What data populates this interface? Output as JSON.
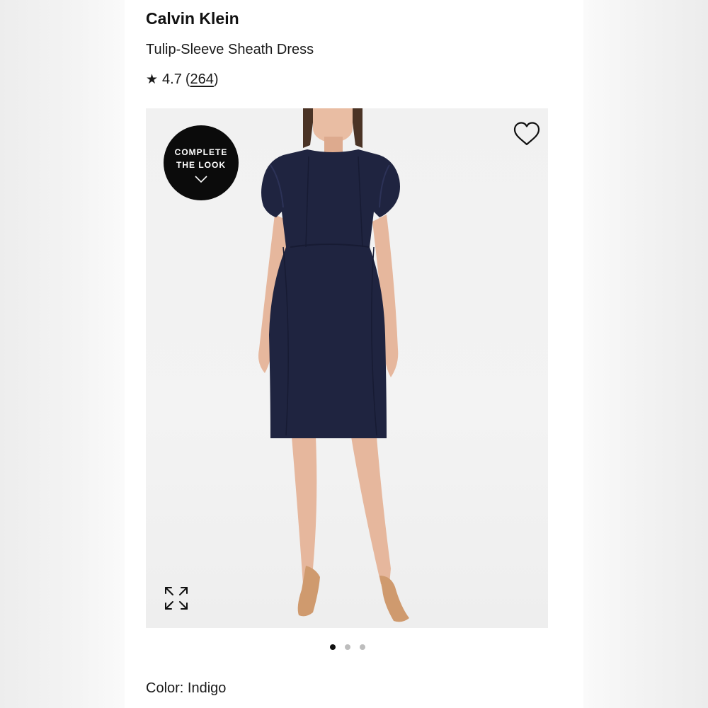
{
  "product": {
    "brand": "Calvin Klein",
    "name": "Tulip-Sleeve Sheath Dress",
    "rating": {
      "star_icon": "★",
      "score": "4.7",
      "open_paren": "(",
      "count": "264",
      "close_paren": ")"
    },
    "color_label": "Color: Indigo"
  },
  "gallery": {
    "complete_the_look": {
      "line1": "COMPLETE",
      "line2": "THE LOOK"
    },
    "icons": {
      "favorite": "heart-outline-icon",
      "expand": "expand-arrows-icon",
      "chevron": "chevron-down-icon"
    },
    "dots": [
      {
        "active": true
      },
      {
        "active": false
      },
      {
        "active": false
      }
    ],
    "dress_color": "#1f2440",
    "skin_color": "#e6b79d",
    "shoe_color": "#cf9a6e"
  }
}
